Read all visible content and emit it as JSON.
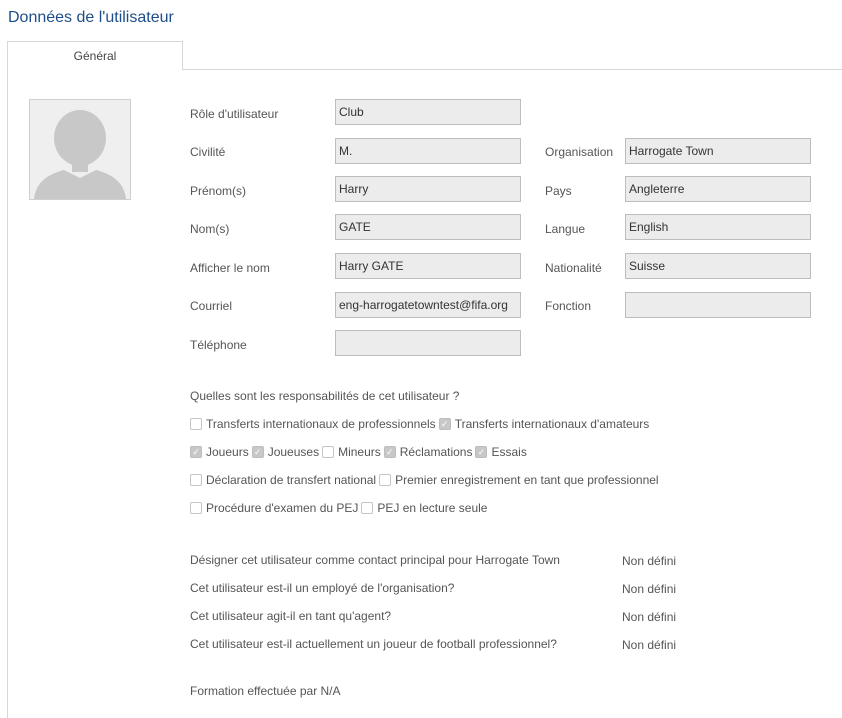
{
  "page": {
    "title": "Données de l'utilisateur"
  },
  "tabs": [
    {
      "label": "Général",
      "active": true
    }
  ],
  "form": {
    "role": {
      "label": "Rôle d'utilisateur",
      "value": "Club"
    },
    "civility": {
      "label": "Civilité",
      "value": "M."
    },
    "first_name": {
      "label": "Prénom(s)",
      "value": "Harry"
    },
    "last_name": {
      "label": "Nom(s)",
      "value": "GATE"
    },
    "display_name": {
      "label": "Afficher le nom",
      "value": "Harry GATE"
    },
    "email": {
      "label": "Courriel",
      "value": "eng-harrogatetowntest@fifa.org"
    },
    "phone": {
      "label": "Téléphone",
      "value": ""
    },
    "organisation": {
      "label": "Organisation",
      "value": "Harrogate Town"
    },
    "country": {
      "label": "Pays",
      "value": "Angleterre"
    },
    "language": {
      "label": "Langue",
      "value": "English"
    },
    "nationality": {
      "label": "Nationalité",
      "value": "Suisse"
    },
    "function": {
      "label": "Fonction",
      "value": ""
    }
  },
  "responsibilities": {
    "question": "Quelles sont les responsabilités de cet utilisateur ?",
    "items": [
      {
        "label": "Transferts internationaux de professionnels",
        "checked": false
      },
      {
        "label": "Transferts internationaux d'amateurs",
        "checked": true
      },
      {
        "label": "Joueurs",
        "checked": true
      },
      {
        "label": "Joueuses",
        "checked": true
      },
      {
        "label": "Mineurs",
        "checked": false
      },
      {
        "label": "Réclamations",
        "checked": true
      },
      {
        "label": "Essais",
        "checked": true
      },
      {
        "label": "Déclaration de transfert national",
        "checked": false
      },
      {
        "label": "Premier enregistrement en tant que professionnel",
        "checked": false
      },
      {
        "label": "Procédure d'examen du PEJ",
        "checked": false
      },
      {
        "label": "PEJ en lecture seule",
        "checked": false
      }
    ]
  },
  "questions": [
    {
      "label": "Désigner cet utilisateur comme contact principal pour Harrogate Town",
      "value": "Non défini"
    },
    {
      "label": "Cet utilisateur est-il un employé de l'organisation?",
      "value": "Non défini"
    },
    {
      "label": "Cet utilisateur agit-il en tant qu'agent?",
      "value": "Non défini"
    },
    {
      "label": "Cet utilisateur est-il actuellement un joueur de football professionnel?",
      "value": "Non défini"
    }
  ],
  "training": "Formation effectuée par N/A",
  "icons": {
    "avatar": "user-silhouette-icon",
    "check": "checkmark-icon"
  }
}
